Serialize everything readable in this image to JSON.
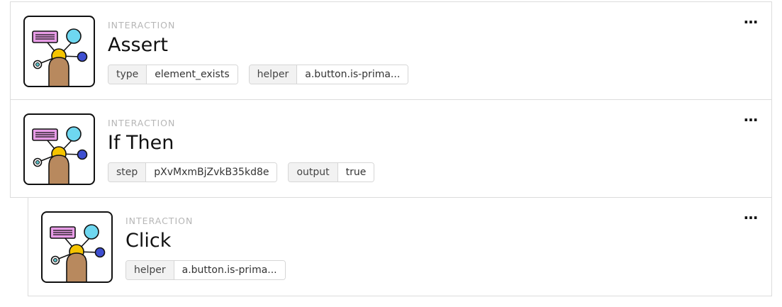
{
  "steps": [
    {
      "kind": "INTERACTION",
      "title": "Assert",
      "tags": [
        {
          "key": "type",
          "value": "element_exists"
        },
        {
          "key": "helper",
          "value": "a.button.is-prima..."
        }
      ],
      "more": "…",
      "icon": "interaction-icon"
    },
    {
      "kind": "INTERACTION",
      "title": "If Then",
      "tags": [
        {
          "key": "step",
          "value": "pXvMxmBjZvkB35kd8e"
        },
        {
          "key": "output",
          "value": "true"
        }
      ],
      "more": "…",
      "icon": "interaction-icon"
    },
    {
      "kind": "INTERACTION",
      "title": "Click",
      "tags": [
        {
          "key": "helper",
          "value": "a.button.is-prima..."
        }
      ],
      "more": "…",
      "icon": "interaction-icon"
    }
  ],
  "colors": {
    "bubble_pink": "#e79ce6",
    "bubble_cyan": "#6ed7f0",
    "node_blue": "#3e4fd1",
    "node_yellow": "#f5c400",
    "hand": "#b8895e",
    "teal": "#5bc0c8"
  }
}
